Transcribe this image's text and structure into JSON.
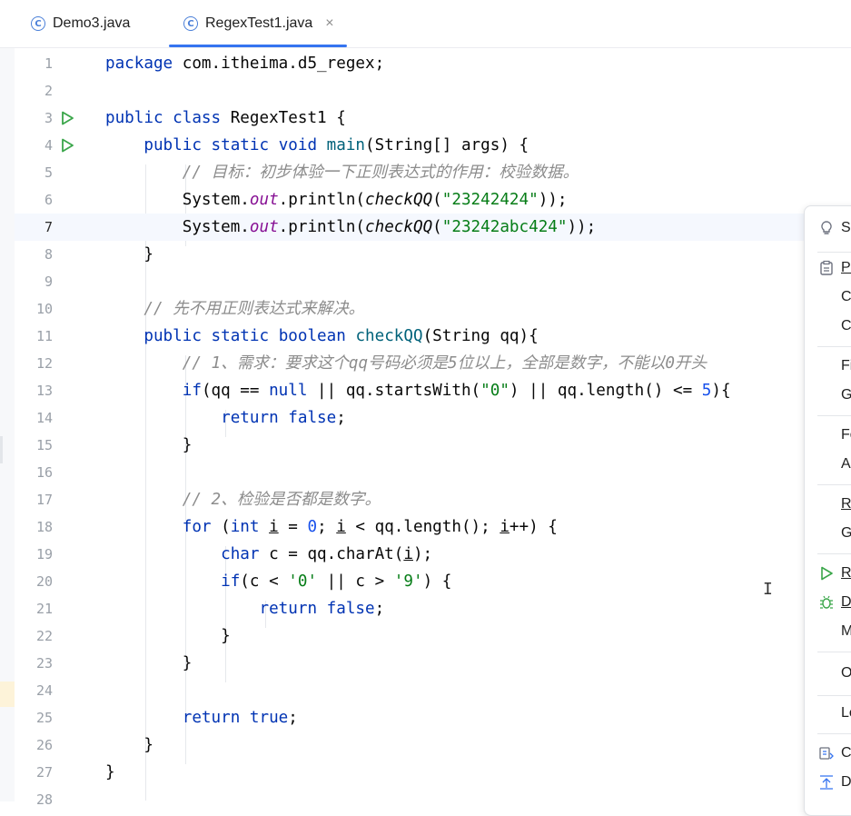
{
  "tabs": [
    {
      "label": "Demo3.java",
      "icon": "java-class-icon",
      "active": false
    },
    {
      "label": "RegexTest1.java",
      "icon": "java-class-icon",
      "active": true,
      "close": "×"
    }
  ],
  "editor": {
    "current_line": 7,
    "line_numbers": [
      "1",
      "2",
      "3",
      "4",
      "5",
      "6",
      "7",
      "8",
      "9",
      "10",
      "11",
      "12",
      "13",
      "14",
      "15",
      "16",
      "17",
      "18",
      "19",
      "20",
      "21",
      "22",
      "23",
      "24",
      "25",
      "26",
      "27",
      "28"
    ],
    "tokens": {
      "l1": [
        "package",
        " com.itheima.d5_regex;"
      ],
      "l3": [
        "public",
        " ",
        "class",
        " RegexTest1 {"
      ],
      "l4": [
        "    ",
        "public",
        " ",
        "static",
        " ",
        "void",
        " ",
        "main",
        "(String[] args) {"
      ],
      "l5": [
        "        // 目标：初步体验一下正则表达式的作用：校验数据。"
      ],
      "l6": [
        "        System.",
        "out",
        ".println(",
        "checkQQ",
        "(",
        "\"23242424\"",
        "));"
      ],
      "l7": [
        "        System.",
        "out",
        ".println(",
        "checkQQ",
        "(",
        "\"23242abc424\"",
        "));"
      ],
      "l8": [
        "    }"
      ],
      "l10": [
        "    // 先不用正则表达式来解决。"
      ],
      "l11": [
        "    ",
        "public",
        " ",
        "static",
        " ",
        "boolean",
        " ",
        "checkQQ",
        "(String qq){"
      ],
      "l12": [
        "        // 1、需求：要求这个qq号码必须是5位以上，全部是数字，不能以0开头"
      ],
      "l13": [
        "        ",
        "if",
        "(qq == ",
        "null",
        " || qq.startsWith(",
        "\"0\"",
        ") || qq.length() <= ",
        "5",
        "){"
      ],
      "l14": [
        "            ",
        "return",
        " ",
        "false",
        ";"
      ],
      "l15": [
        "        }"
      ],
      "l17": [
        "        // 2、检验是否都是数字。"
      ],
      "l18": [
        "        ",
        "for",
        " (",
        "int",
        " ",
        "i",
        " = ",
        "0",
        "; ",
        "i",
        " < qq.length(); ",
        "i",
        "++) {"
      ],
      "l19": [
        "            ",
        "char",
        " c = qq.charAt(",
        "i",
        ");"
      ],
      "l20": [
        "            ",
        "if",
        "(c < ",
        "'0'",
        " || c > ",
        "'9'",
        ") {"
      ],
      "l21": [
        "                ",
        "return",
        " ",
        "false",
        ";"
      ],
      "l22": [
        "            }"
      ],
      "l23": [
        "        }"
      ],
      "l25": [
        "        ",
        "return",
        " ",
        "true",
        ";"
      ],
      "l26": [
        "    }"
      ],
      "l27": [
        "}"
      ]
    }
  },
  "context_menu": {
    "items": [
      {
        "label": "Sh",
        "icon": "lightbulb-icon"
      },
      {
        "label": "Pa",
        "icon": "paste-icon"
      },
      {
        "label": "C"
      },
      {
        "label": "C"
      },
      {
        "label": "Fi"
      },
      {
        "label": "G"
      },
      {
        "label": "Fo"
      },
      {
        "label": "A"
      },
      {
        "label": "Re"
      },
      {
        "label": "G"
      },
      {
        "label": "Ru",
        "icon": "run-icon"
      },
      {
        "label": "D",
        "icon": "debug-bug-icon"
      },
      {
        "label": "M"
      },
      {
        "label": "O"
      },
      {
        "label": "Lo"
      },
      {
        "label": "C",
        "icon": "compare-icon"
      },
      {
        "label": "D",
        "icon": "diagram-icon"
      }
    ]
  },
  "colors": {
    "keyword": "#0033b3",
    "string": "#067d17",
    "number": "#1750eb",
    "comment": "#8c8c8c",
    "field": "#871094",
    "run_gutter": "#3aa64a",
    "tab_accent": "#3574f0"
  }
}
